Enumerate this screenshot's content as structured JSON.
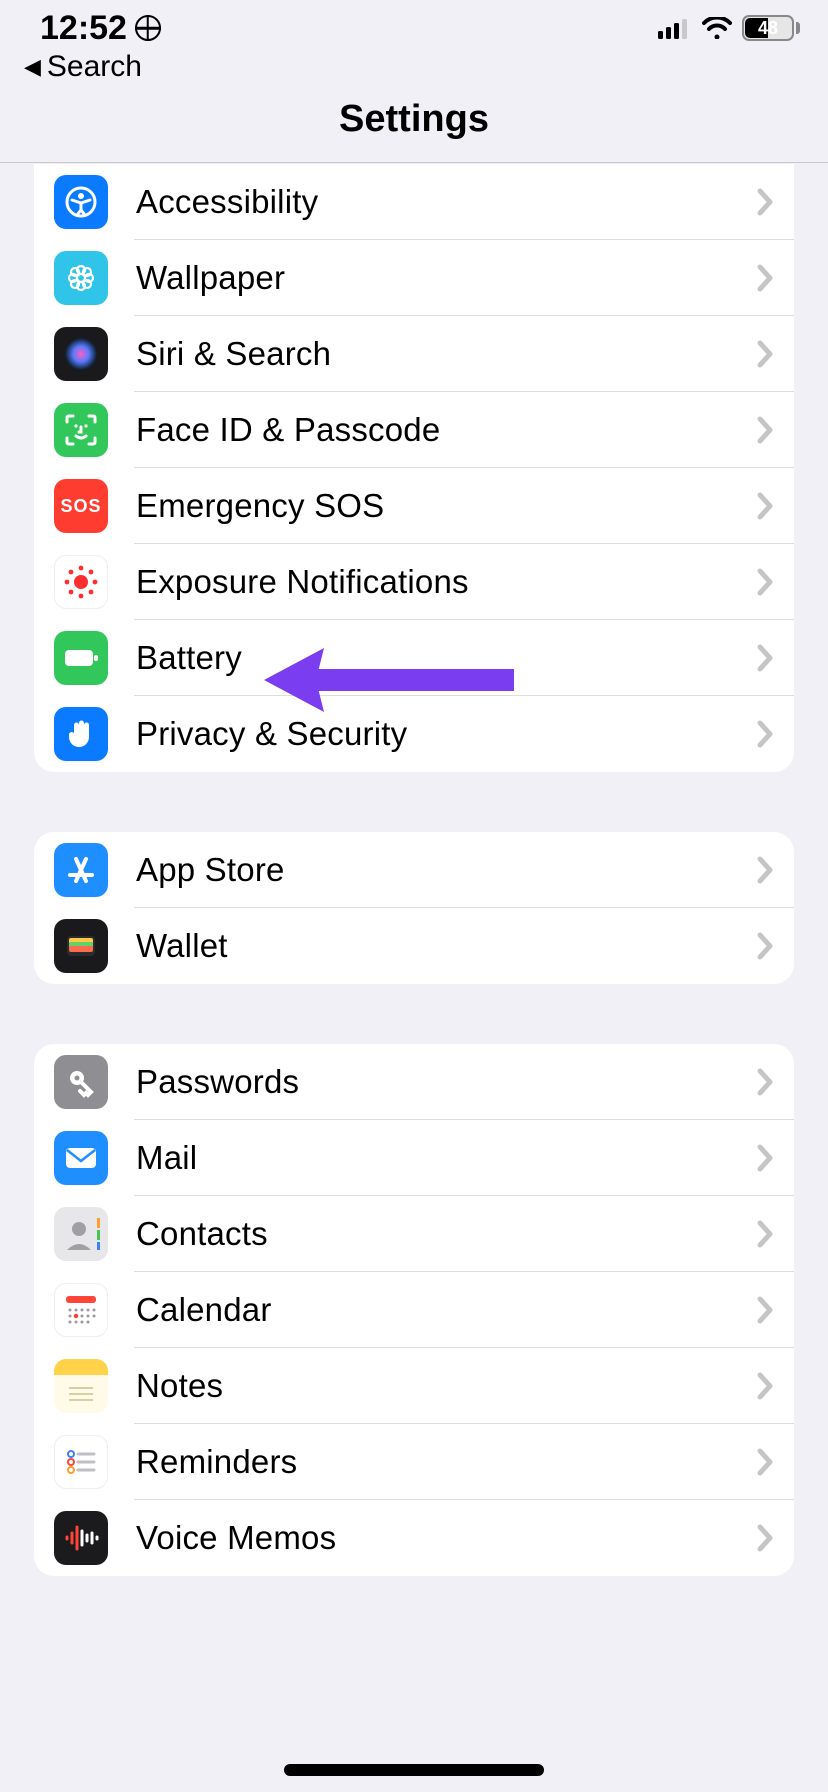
{
  "status": {
    "time": "12:52",
    "battery_text": "48",
    "battery_percent": 48
  },
  "nav": {
    "back_label": "Search"
  },
  "page": {
    "title": "Settings"
  },
  "groups": [
    {
      "id": "general",
      "items": [
        {
          "id": "accessibility",
          "label": "Accessibility",
          "icon": "accessibility-icon",
          "bg": "bg-blue"
        },
        {
          "id": "wallpaper",
          "label": "Wallpaper",
          "icon": "wallpaper-icon",
          "bg": "bg-cyan"
        },
        {
          "id": "siri",
          "label": "Siri & Search",
          "icon": "siri-icon",
          "bg": "bg-black"
        },
        {
          "id": "faceid",
          "label": "Face ID & Passcode",
          "icon": "faceid-icon",
          "bg": "bg-green"
        },
        {
          "id": "sos",
          "label": "Emergency SOS",
          "icon": "sos-icon",
          "bg": "bg-red",
          "icon_text": "SOS"
        },
        {
          "id": "exposure",
          "label": "Exposure Notifications",
          "icon": "exposure-icon",
          "bg": "bg-white"
        },
        {
          "id": "battery",
          "label": "Battery",
          "icon": "battery-icon",
          "bg": "bg-green"
        },
        {
          "id": "privacy",
          "label": "Privacy & Security",
          "icon": "hand-icon",
          "bg": "bg-blue"
        }
      ]
    },
    {
      "id": "store",
      "items": [
        {
          "id": "appstore",
          "label": "App Store",
          "icon": "appstore-icon",
          "bg": "bg-blue2"
        },
        {
          "id": "wallet",
          "label": "Wallet",
          "icon": "wallet-icon",
          "bg": "bg-black"
        }
      ]
    },
    {
      "id": "apps",
      "items": [
        {
          "id": "passwords",
          "label": "Passwords",
          "icon": "key-icon",
          "bg": "bg-gray"
        },
        {
          "id": "mail",
          "label": "Mail",
          "icon": "mail-icon",
          "bg": "bg-blue2"
        },
        {
          "id": "contacts",
          "label": "Contacts",
          "icon": "contacts-icon",
          "bg": "bg-contacts"
        },
        {
          "id": "calendar",
          "label": "Calendar",
          "icon": "calendar-icon",
          "bg": "bg-white"
        },
        {
          "id": "notes",
          "label": "Notes",
          "icon": "notes-icon",
          "bg": "bg-notes"
        },
        {
          "id": "reminders",
          "label": "Reminders",
          "icon": "reminders-icon",
          "bg": "bg-white"
        },
        {
          "id": "voicememos",
          "label": "Voice Memos",
          "icon": "voicememos-icon",
          "bg": "bg-memos"
        }
      ]
    }
  ],
  "annotation": {
    "target": "battery",
    "color": "#7a3df0"
  }
}
